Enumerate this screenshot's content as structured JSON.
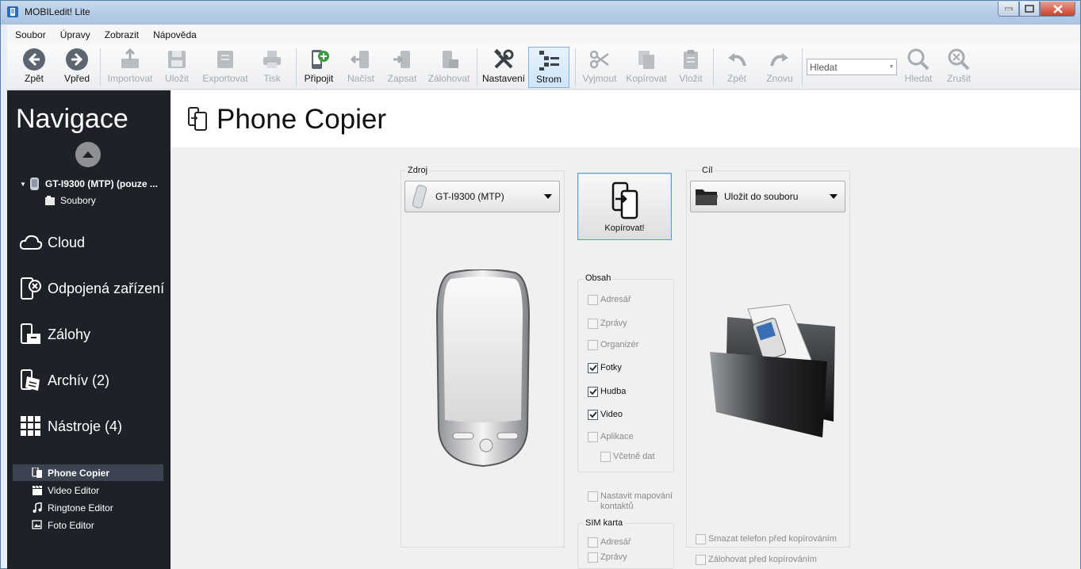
{
  "window": {
    "title": "MOBILedit! Lite"
  },
  "menu": {
    "items": [
      "Soubor",
      "Úpravy",
      "Zobrazit",
      "Nápověda"
    ]
  },
  "toolbar": {
    "back": "Zpět",
    "forward": "Vpřed",
    "import": "Importovat",
    "save": "Uložit",
    "export": "Exportovat",
    "print": "Tisk",
    "connect": "Připojit",
    "load": "Načíst",
    "write": "Zapsat",
    "backup": "Zálohovat",
    "settings": "Nastavení",
    "tree": "Strom",
    "cut": "Vyjmout",
    "copy": "Kopírovat",
    "paste": "Vložit",
    "undo": "Zpět",
    "redo": "Znovu",
    "search_value": "Hledat",
    "search": "Hledat",
    "cancel": "Zrušit"
  },
  "sidebar": {
    "title": "Navigace",
    "device": "GT-I9300 (MTP) (pouze ...",
    "files": "Soubory",
    "sections": {
      "cloud": "Cloud",
      "disconnected": "Odpojená zařízení",
      "backups": "Zálohy",
      "archive": "Archív (2)",
      "tools": "Nástroje (4)"
    },
    "tools": [
      "Phone Copier",
      "Video Editor",
      "Ringtone Editor",
      "Foto Editor"
    ]
  },
  "page": {
    "title": "Phone Copier"
  },
  "source": {
    "label": "Zdroj",
    "value": "GT-I9300 (MTP)"
  },
  "target": {
    "label": "Cíl",
    "value": "Uložit do souboru"
  },
  "copy_button": "Kopírovat!",
  "content": {
    "label": "Obsah",
    "items": [
      {
        "label": "Adresář",
        "checked": false
      },
      {
        "label": "Zprávy",
        "checked": false
      },
      {
        "label": "Organizér",
        "checked": false
      },
      {
        "label": "Fotky",
        "checked": true
      },
      {
        "label": "Hudba",
        "checked": true
      },
      {
        "label": "Video",
        "checked": true
      },
      {
        "label": "Aplikace",
        "checked": false
      },
      {
        "label": "Včetně dat",
        "checked": false
      }
    ]
  },
  "mapping": {
    "label": "Nastavit mapování kontaktů",
    "checked": false
  },
  "sim": {
    "label": "SIM karta",
    "items": [
      {
        "label": "Adresář",
        "checked": false
      },
      {
        "label": "Zprávy",
        "checked": false
      }
    ]
  },
  "target_options": [
    {
      "label": "Smazat telefon před kopírováním",
      "checked": false
    },
    {
      "label": "Zálohovat před kopírováním",
      "checked": false
    }
  ],
  "colors": {
    "sidebar": "#1e2128",
    "accent": "#5a9ad6",
    "selected": "#3c4452"
  }
}
